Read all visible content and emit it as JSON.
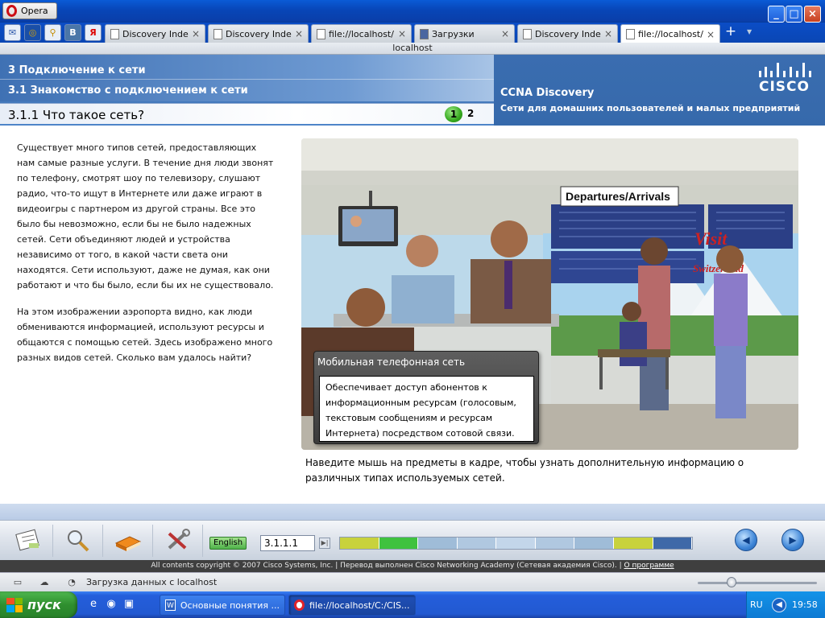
{
  "browser": {
    "app_name": "Opera",
    "address": "localhost",
    "quick_icons": [
      "mail-icon",
      "opera-icon",
      "search-icon",
      "vk-icon",
      "yandex-icon"
    ],
    "quick_labels": [
      "✉",
      "◎",
      "⚲",
      "В",
      "Я"
    ],
    "tabs": [
      {
        "label": "Discovery Index",
        "active": false
      },
      {
        "label": "Discovery Index",
        "active": false
      },
      {
        "label": "file://localhost/...",
        "active": false
      },
      {
        "label": "Загрузки",
        "active": false
      },
      {
        "label": "Discovery Index",
        "active": false
      },
      {
        "label": "file://localhost/...",
        "active": true
      }
    ],
    "new_tab": "+",
    "close_glyph": "×"
  },
  "course": {
    "chapter": "3 Подключение к сети",
    "section": "3.1 Знакомство с подключением к сети",
    "page_title": "3.1.1 Что такое сеть?",
    "page_current": "1",
    "page_next": "2",
    "brand": "CCNA Discovery",
    "brand_sub": "Сети для домашних пользователей и малых предприятий",
    "logo_text": "CISCO"
  },
  "content": {
    "paragraph1": "Существует много типов сетей, предоставляющих нам самые разные услуги. В течение дня люди звонят по телефону, смотрят шоу по телевизору, слушают радио, что-то ищут в Интернете или даже играют в видеоигры с партнером из другой страны. Все это было бы невозможно, если бы не было надежных сетей. Сети объединяют людей и устройства независимо от того, в какой части света они находятся. Сети используют, даже не думая, как они работают и что бы было, если бы их не существовало.",
    "paragraph2": "На этом изображении аэропорта видно, как люди обмениваются информацией, используют ресурсы и общаются с помощью сетей. Здесь изображено много разных видов сетей. Сколько вам удалось найти?",
    "scene_sign": "Departures/Arrivals",
    "scene_visit": "Visit",
    "scene_swiss": "Switzerland",
    "popup_title": "Мобильная телефонная сеть",
    "popup_body": "Обеспечивает доступ абонентов к информационным ресурсам (голосовым, текстовым сообщениям и ресурсам Интернета) посредством сотовой связи.",
    "caption": "Наведите мышь на предметы в кадре, чтобы узнать дополнительную информацию о различных типах используемых сетей."
  },
  "toolbar": {
    "language": "English",
    "page_field": "3.1.1.1",
    "go_glyph": "▶|",
    "progress_colors": [
      "#c8d23c",
      "#3fc23f",
      "#9fbcd8",
      "#b0c8e0",
      "#c3d6ea",
      "#b0c8e0",
      "#9fbcd8",
      "#c8d23c",
      "#3f69a8"
    ],
    "copyright": "All contents copyright © 2007 Cisco Systems, Inc. | Перевод выполнен Cisco Networking Academy (Сетевая академия Cisco). |",
    "about_link": "О программе"
  },
  "status": {
    "text": "Загрузка данных с localhost"
  },
  "taskbar": {
    "start": "пуск",
    "tasks": [
      {
        "label": "Основные понятия ...",
        "active": false
      },
      {
        "label": "file://localhost/C:/CIS...",
        "active": true
      }
    ],
    "lang": "RU",
    "clock": "19:58"
  },
  "colors": {
    "header_blue": "#3f73b6",
    "accent_green": "#35a81e",
    "taskbar_blue": "#245edb"
  }
}
